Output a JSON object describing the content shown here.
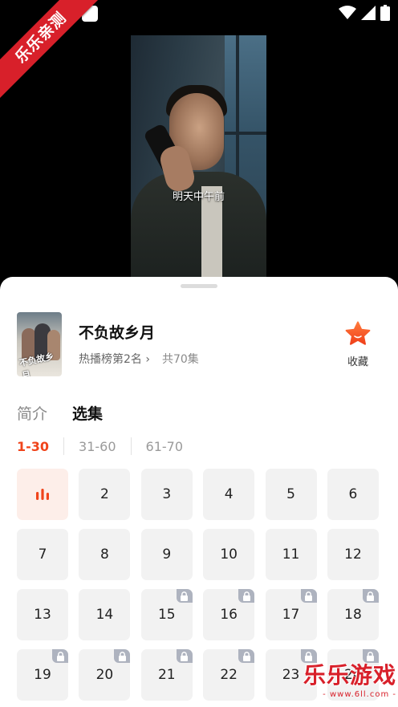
{
  "status_bar": {
    "icons": [
      "app-square-icon",
      "app-square-icon",
      "wifi-icon",
      "signal-icon",
      "battery-icon"
    ]
  },
  "badge": {
    "text": "乐乐亲测"
  },
  "video": {
    "subtitle": "明天中午前"
  },
  "drama": {
    "title": "不负故乡月",
    "poster_text": "不负故乡月",
    "rank": "热播榜第2名",
    "chevron": "›",
    "episodes_total": "共70集",
    "favorite_label": "收藏"
  },
  "tabs": [
    {
      "label": "简介"
    },
    {
      "label": "选集",
      "active": true
    }
  ],
  "ranges": [
    {
      "label": "1-30",
      "active": true
    },
    {
      "label": "31-60"
    },
    {
      "label": "61-70"
    }
  ],
  "episodes": [
    {
      "label": "",
      "playing": true,
      "locked": false
    },
    {
      "label": "2",
      "locked": false
    },
    {
      "label": "3",
      "locked": false
    },
    {
      "label": "4",
      "locked": false
    },
    {
      "label": "5",
      "locked": false
    },
    {
      "label": "6",
      "locked": false
    },
    {
      "label": "7",
      "locked": false
    },
    {
      "label": "8",
      "locked": false
    },
    {
      "label": "9",
      "locked": false
    },
    {
      "label": "10",
      "locked": false
    },
    {
      "label": "11",
      "locked": false
    },
    {
      "label": "12",
      "locked": false
    },
    {
      "label": "13",
      "locked": false
    },
    {
      "label": "14",
      "locked": false
    },
    {
      "label": "15",
      "locked": true
    },
    {
      "label": "16",
      "locked": true
    },
    {
      "label": "17",
      "locked": true
    },
    {
      "label": "18",
      "locked": true
    },
    {
      "label": "19",
      "locked": true
    },
    {
      "label": "20",
      "locked": true
    },
    {
      "label": "21",
      "locked": true
    },
    {
      "label": "22",
      "locked": true
    },
    {
      "label": "23",
      "locked": true
    },
    {
      "label": "24",
      "locked": true
    }
  ],
  "watermark": {
    "title": "乐乐游戏",
    "url": "- www.6ll.com -"
  },
  "colors": {
    "accent": "#f0441b",
    "badge_red": "#d8202a",
    "lock_gray": "#aeb3bf",
    "playing_bg": "#fdeee9"
  }
}
